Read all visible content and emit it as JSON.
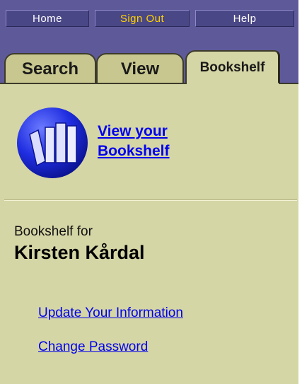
{
  "topnav": {
    "items": [
      {
        "label": "Home"
      },
      {
        "label": "Sign Out"
      },
      {
        "label": "Help"
      }
    ]
  },
  "tabs": [
    {
      "label": "Search",
      "active": false
    },
    {
      "label": "View",
      "active": false
    },
    {
      "label": "Bookshelf",
      "active": true
    }
  ],
  "view_link": {
    "line1": "View your",
    "line2": "Bookshelf"
  },
  "owner": {
    "label": "Bookshelf for",
    "name": "Kirsten Kårdal"
  },
  "links": {
    "update": "Update Your Information",
    "password": "Change Password"
  },
  "colors": {
    "nav_bg": "#5e5a9a",
    "panel_bg": "#d5d6a5",
    "link": "#0000ee",
    "signout": "#ffd200"
  },
  "icons": {
    "bookshelf": "bookshelf-icon"
  }
}
